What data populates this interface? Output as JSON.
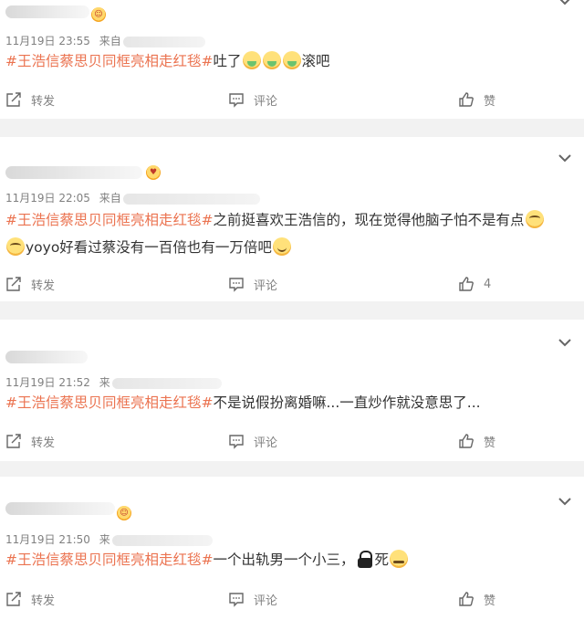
{
  "actions": {
    "repost_label": "转发",
    "comment_label": "评论",
    "like_label": "赞"
  },
  "comments": [
    {
      "time": "11月19日 23:55",
      "source_prefix": "来自",
      "hashtag": "#王浩信蔡思贝同框亮相走红毯#",
      "text_before": "吐了",
      "text_after": "滚吧",
      "like_count": "赞"
    },
    {
      "time": "11月19日 22:05",
      "source_prefix": "来自",
      "hashtag": "#王浩信蔡思贝同框亮相走红毯#",
      "line1": "之前挺喜欢王浩信的，现在觉得他脑子怕不是有点",
      "line2": "yoyo好看过蔡没有一百倍也有一万倍吧",
      "like_count": "4"
    },
    {
      "time": "11月19日 21:52",
      "source_prefix": "来",
      "hashtag": "#王浩信蔡思贝同框亮相走红毯#",
      "text": "不是说假扮离婚嘛...一直炒作就没意思了...",
      "like_count": "赞"
    },
    {
      "time": "11月19日 21:50",
      "source_prefix": "来",
      "hashtag": "#王浩信蔡思贝同框亮相走红毯#",
      "text_before": "一个出轨男一个小三，",
      "text_after": "死",
      "like_count": "赞"
    }
  ]
}
